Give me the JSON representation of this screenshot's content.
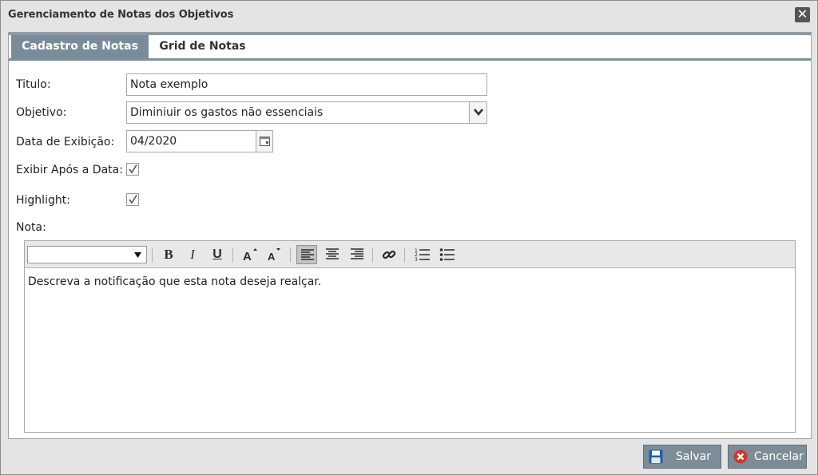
{
  "dialog": {
    "title": "Gerenciamento de Notas dos Objetivos",
    "close_glyph": "✕"
  },
  "tabs": [
    {
      "label": "Cadastro de Notas",
      "active": true
    },
    {
      "label": "Grid de Notas",
      "active": false
    }
  ],
  "form": {
    "titulo_label": "Titulo:",
    "titulo_value": "Nota exemplo",
    "objetivo_label": "Objetivo:",
    "objetivo_value": "Diminiuir os gastos não essenciais",
    "data_label": "Data de Exibição:",
    "data_value": "04/2020",
    "exibir_label": "Exibir Após a Data:",
    "exibir_checked": true,
    "highlight_label": "Highlight:",
    "highlight_checked": true,
    "nota_label": "Nota:"
  },
  "editor": {
    "font_value": "",
    "toolbar_icons": [
      "bold-icon",
      "italic-icon",
      "underline-icon",
      "font-grow-icon",
      "font-shrink-icon",
      "align-left-icon",
      "align-center-icon",
      "align-right-icon",
      "link-icon",
      "ordered-list-icon",
      "unordered-list-icon"
    ],
    "content": "Descreva a notificação que esta nota deseja realçar."
  },
  "footer": {
    "save_label": "Salvar",
    "cancel_label": "Cancelar"
  },
  "colors": {
    "tab_active": "#7a8c99",
    "button_bg": "#7d8d98",
    "cancel_icon": "#d9332b",
    "save_icon": "#1f5fa8"
  }
}
